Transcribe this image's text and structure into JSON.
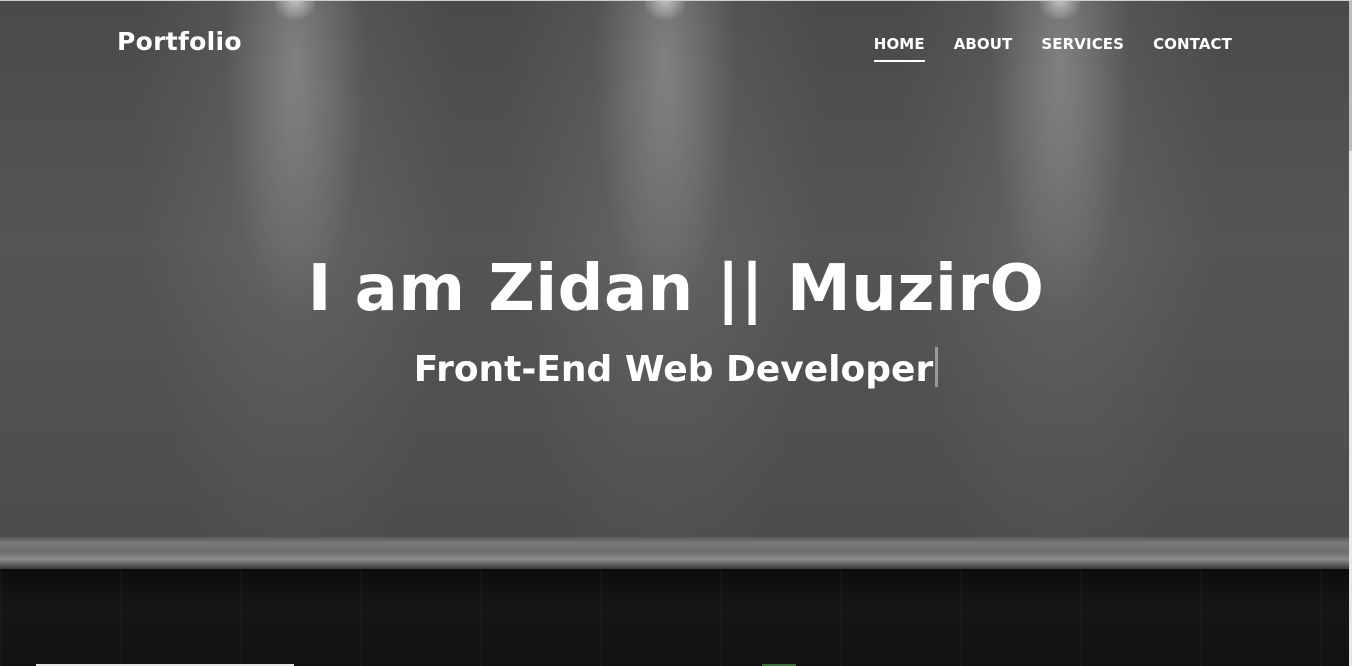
{
  "navbar": {
    "brand": "Portfolio",
    "links": [
      {
        "label": "HOME",
        "active": true
      },
      {
        "label": "ABOUT",
        "active": false
      },
      {
        "label": "SERVICES",
        "active": false
      },
      {
        "label": "CONTACT",
        "active": false
      }
    ]
  },
  "hero": {
    "title": "I am Zidan || MuzirO",
    "subtitle": "Front-End Web Developer"
  },
  "colors": {
    "text": "#ffffff",
    "wall": "#4f4f4f",
    "floor": "#121212"
  }
}
